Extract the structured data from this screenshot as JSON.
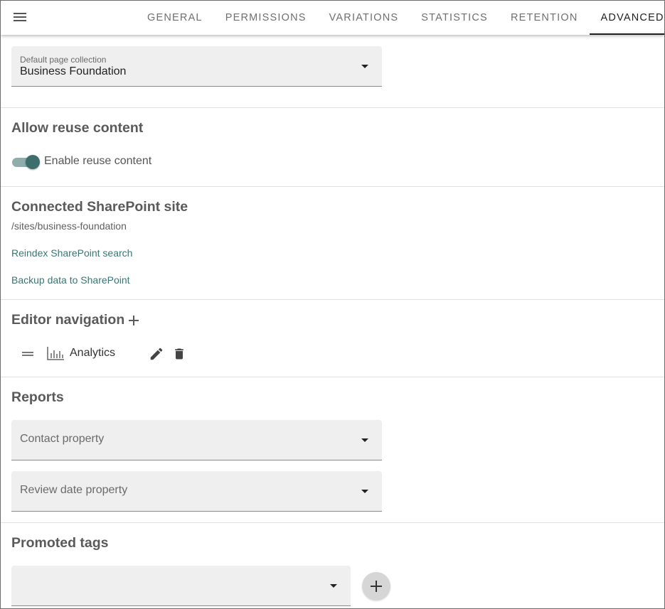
{
  "tabs": [
    {
      "label": "GENERAL",
      "active": false
    },
    {
      "label": "PERMISSIONS",
      "active": false
    },
    {
      "label": "VARIATIONS",
      "active": false
    },
    {
      "label": "STATISTICS",
      "active": false
    },
    {
      "label": "RETENTION",
      "active": false
    },
    {
      "label": "ADVANCED",
      "active": true
    }
  ],
  "page_collection": {
    "label": "Default page collection",
    "value": "Business Foundation"
  },
  "reuse": {
    "heading": "Allow reuse content",
    "toggle_label": "Enable reuse content",
    "enabled": true
  },
  "sharepoint": {
    "heading": "Connected SharePoint site",
    "path": "/sites/business-foundation",
    "reindex_link": "Reindex SharePoint search",
    "backup_link": "Backup data to SharePoint"
  },
  "editor_navigation": {
    "heading": "Editor navigation",
    "items": [
      {
        "label": "Analytics",
        "icon": "bar-chart-icon"
      }
    ]
  },
  "reports": {
    "heading": "Reports",
    "contact_placeholder": "Contact property",
    "review_date_placeholder": "Review date property"
  },
  "promoted_tags": {
    "heading": "Promoted tags",
    "value": ""
  },
  "colors": {
    "accent": "#3d6e6c",
    "link": "#3b7573",
    "field_bg": "#efefef"
  }
}
